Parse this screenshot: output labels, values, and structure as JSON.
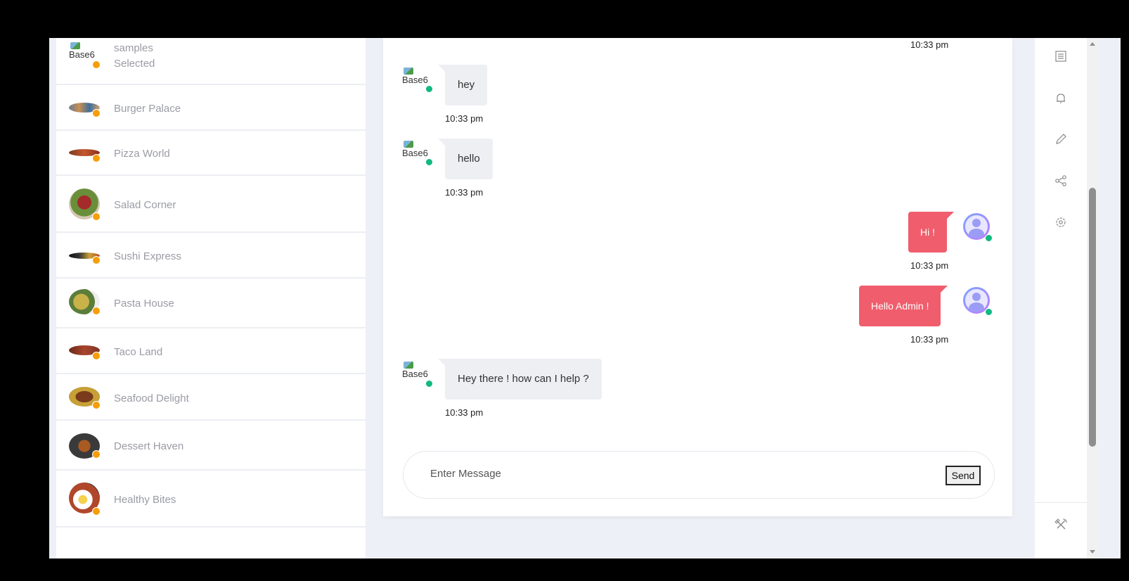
{
  "sidebar": {
    "contacts": [
      {
        "name": "samples",
        "status": "Selected",
        "avatar_alt": "Base6"
      },
      {
        "name": "Burger Palace"
      },
      {
        "name": "Pizza World"
      },
      {
        "name": "Salad Corner"
      },
      {
        "name": "Sushi Express"
      },
      {
        "name": "Pasta House"
      },
      {
        "name": "Taco Land"
      },
      {
        "name": "Seafood Delight"
      },
      {
        "name": "Dessert Haven"
      },
      {
        "name": "Healthy Bites"
      }
    ]
  },
  "chat": {
    "top_time": "10:33 pm",
    "messages": [
      {
        "direction": "incoming",
        "text": "hey",
        "time": "10:33 pm",
        "avatar_alt": "Base6"
      },
      {
        "direction": "incoming",
        "text": "hello",
        "time": "10:33 pm",
        "avatar_alt": "Base6"
      },
      {
        "direction": "outgoing",
        "text": "Hi !",
        "time": "10:33 pm"
      },
      {
        "direction": "outgoing",
        "text": "Hello Admin !",
        "time": "10:33 pm"
      },
      {
        "direction": "incoming",
        "text": "Hey there ! how can I help ?",
        "time": "10:33 pm",
        "avatar_alt": "Base6"
      }
    ],
    "composer": {
      "placeholder": "Enter Message",
      "send_label": "Send"
    }
  },
  "rail": {
    "icons": [
      "list-icon",
      "bell-icon",
      "pencil-icon",
      "share-icon",
      "gear-icon",
      "tools-icon"
    ]
  },
  "colors": {
    "outgoing_bubble": "#f05d6c",
    "incoming_bubble": "#eeeff3",
    "online_dot": "#10b981",
    "away_dot": "#f59e0b"
  }
}
